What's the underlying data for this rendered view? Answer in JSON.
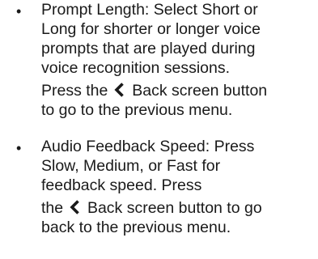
{
  "items": [
    {
      "bullet": "•",
      "lines": [
        "Prompt Length: Select Short or",
        "Long for shorter or longer voice",
        "prompts that are played during",
        "voice recognition sessions."
      ],
      "back_before": "Press the",
      "back_label": "Back screen button",
      "back_after": "to go to the previous menu."
    },
    {
      "bullet": "•",
      "lines": [
        "Audio Feedback Speed: Press",
        "Slow, Medium, or Fast for",
        "feedback speed. Press"
      ],
      "back_before": "the",
      "back_label": "Back screen button to go",
      "back_after": "back to the previous menu."
    }
  ],
  "icons": {
    "back": "back-chevron-icon"
  }
}
